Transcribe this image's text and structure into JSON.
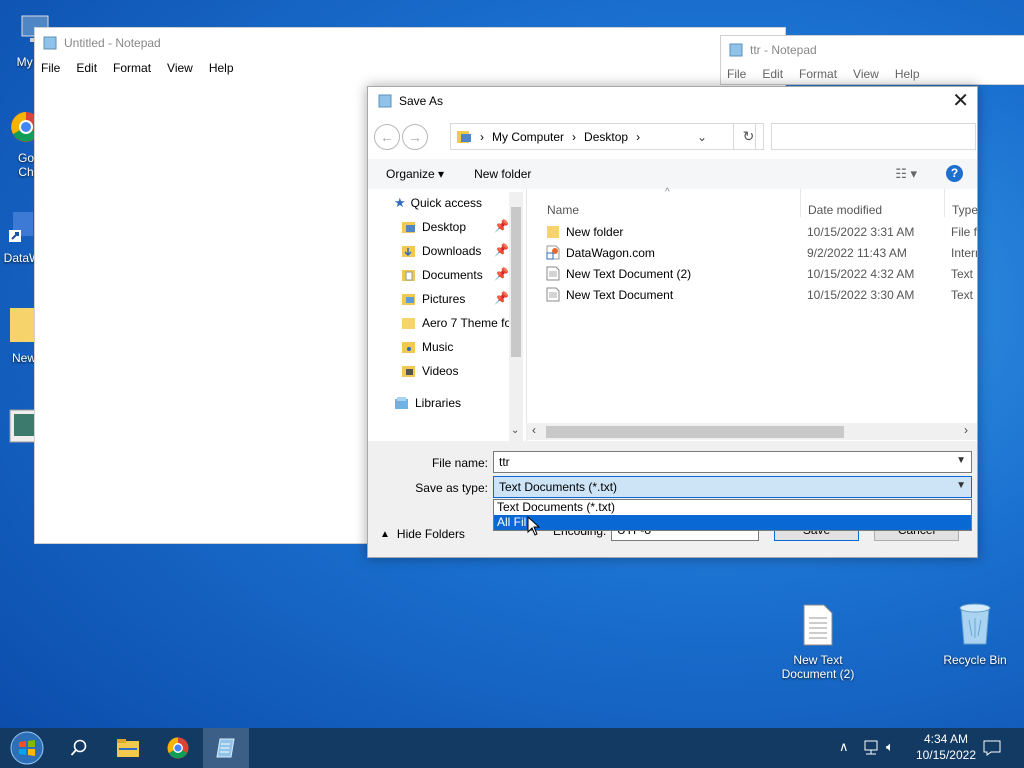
{
  "desktop": {
    "icons_left": [
      {
        "label": "My Co"
      },
      {
        "label": "Go\nCh"
      },
      {
        "label": "DataW"
      },
      {
        "label": "New"
      },
      {
        "label": ""
      }
    ],
    "icons_right": [
      {
        "label": "New Text\nDocument (2)"
      },
      {
        "label": "Recycle Bin"
      }
    ]
  },
  "notepad_main": {
    "title": "Untitled - Notepad",
    "menu": [
      "File",
      "Edit",
      "Format",
      "View",
      "Help"
    ]
  },
  "notepad_second": {
    "title": "ttr - Notepad",
    "menu": [
      "File",
      "Edit",
      "Format",
      "View",
      "Help"
    ]
  },
  "dialog": {
    "title": "Save As",
    "breadcrumb": [
      "My Computer",
      "Desktop"
    ],
    "toolbar": {
      "organize": "Organize",
      "new_folder": "New folder"
    },
    "nav": {
      "quick_access": "Quick access",
      "items": [
        "Desktop",
        "Downloads",
        "Documents",
        "Pictures",
        "Aero 7 Theme fo",
        "Music",
        "Videos"
      ],
      "libraries": "Libraries"
    },
    "columns": {
      "name": "Name",
      "date": "Date modified",
      "type": "Type"
    },
    "files": [
      {
        "name": "New folder",
        "date": "10/15/2022 3:31 AM",
        "type": "File fo",
        "icon": "folder-icon"
      },
      {
        "name": "DataWagon.com",
        "date": "9/2/2022 11:43 AM",
        "type": "Intern",
        "icon": "shortcut-icon"
      },
      {
        "name": "New Text Document (2)",
        "date": "10/15/2022 4:32 AM",
        "type": "Text D",
        "icon": "text-file-icon"
      },
      {
        "name": "New Text Document",
        "date": "10/15/2022 3:30 AM",
        "type": "Text D",
        "icon": "text-file-icon"
      }
    ],
    "filename_label": "File name:",
    "filename_value": "ttr",
    "savetype_label": "Save as type:",
    "savetype_value": "Text Documents (*.txt)",
    "savetype_options": [
      "Text Documents (*.txt)",
      "All Fil"
    ],
    "encoding_label": "Encoding:",
    "encoding_value": "UTF-8",
    "save_button": "Save",
    "cancel_button": "Cancel",
    "hide_folders": "Hide Folders"
  },
  "taskbar": {
    "time": "4:34 AM",
    "date": "10/15/2022"
  }
}
